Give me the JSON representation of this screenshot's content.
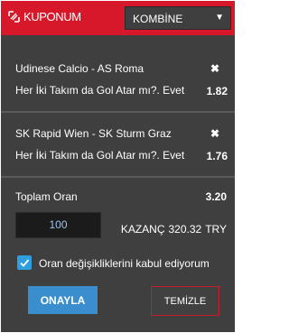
{
  "header": {
    "brand_label": "KUPONUM",
    "brand_icon": "betslip-icon",
    "bet_type_select": {
      "value": "KOMBİNE"
    }
  },
  "bets": [
    {
      "match": "Udinese Calcio - AS Roma",
      "market": "Her İki Takım da Gol Atar mı?. Evet",
      "odds": "1.82",
      "remove_icon": "✖"
    },
    {
      "match": "SK Rapid Wien - SK Sturm Graz",
      "market": "Her İki Takım da Gol Atar mı?. Evet",
      "odds": "1.76",
      "remove_icon": "✖"
    }
  ],
  "summary": {
    "total_odds_label": "Toplam Oran",
    "total_odds_value": "3.20",
    "stake_value": "100",
    "winnings_label": "KAZANÇ",
    "winnings_amount": "320.32",
    "currency": "TRY"
  },
  "accept_changes": {
    "checked": true,
    "label": "Oran değişikliklerini kabul ediyorum"
  },
  "actions": {
    "confirm_label": "ONAYLA",
    "clear_label": "TEMİZLE"
  },
  "colors": {
    "header_red": "#d7182a",
    "panel_dark": "#3f3f3f",
    "accent_blue": "#3a8ece",
    "stake_text_blue": "#9fc3e8"
  }
}
